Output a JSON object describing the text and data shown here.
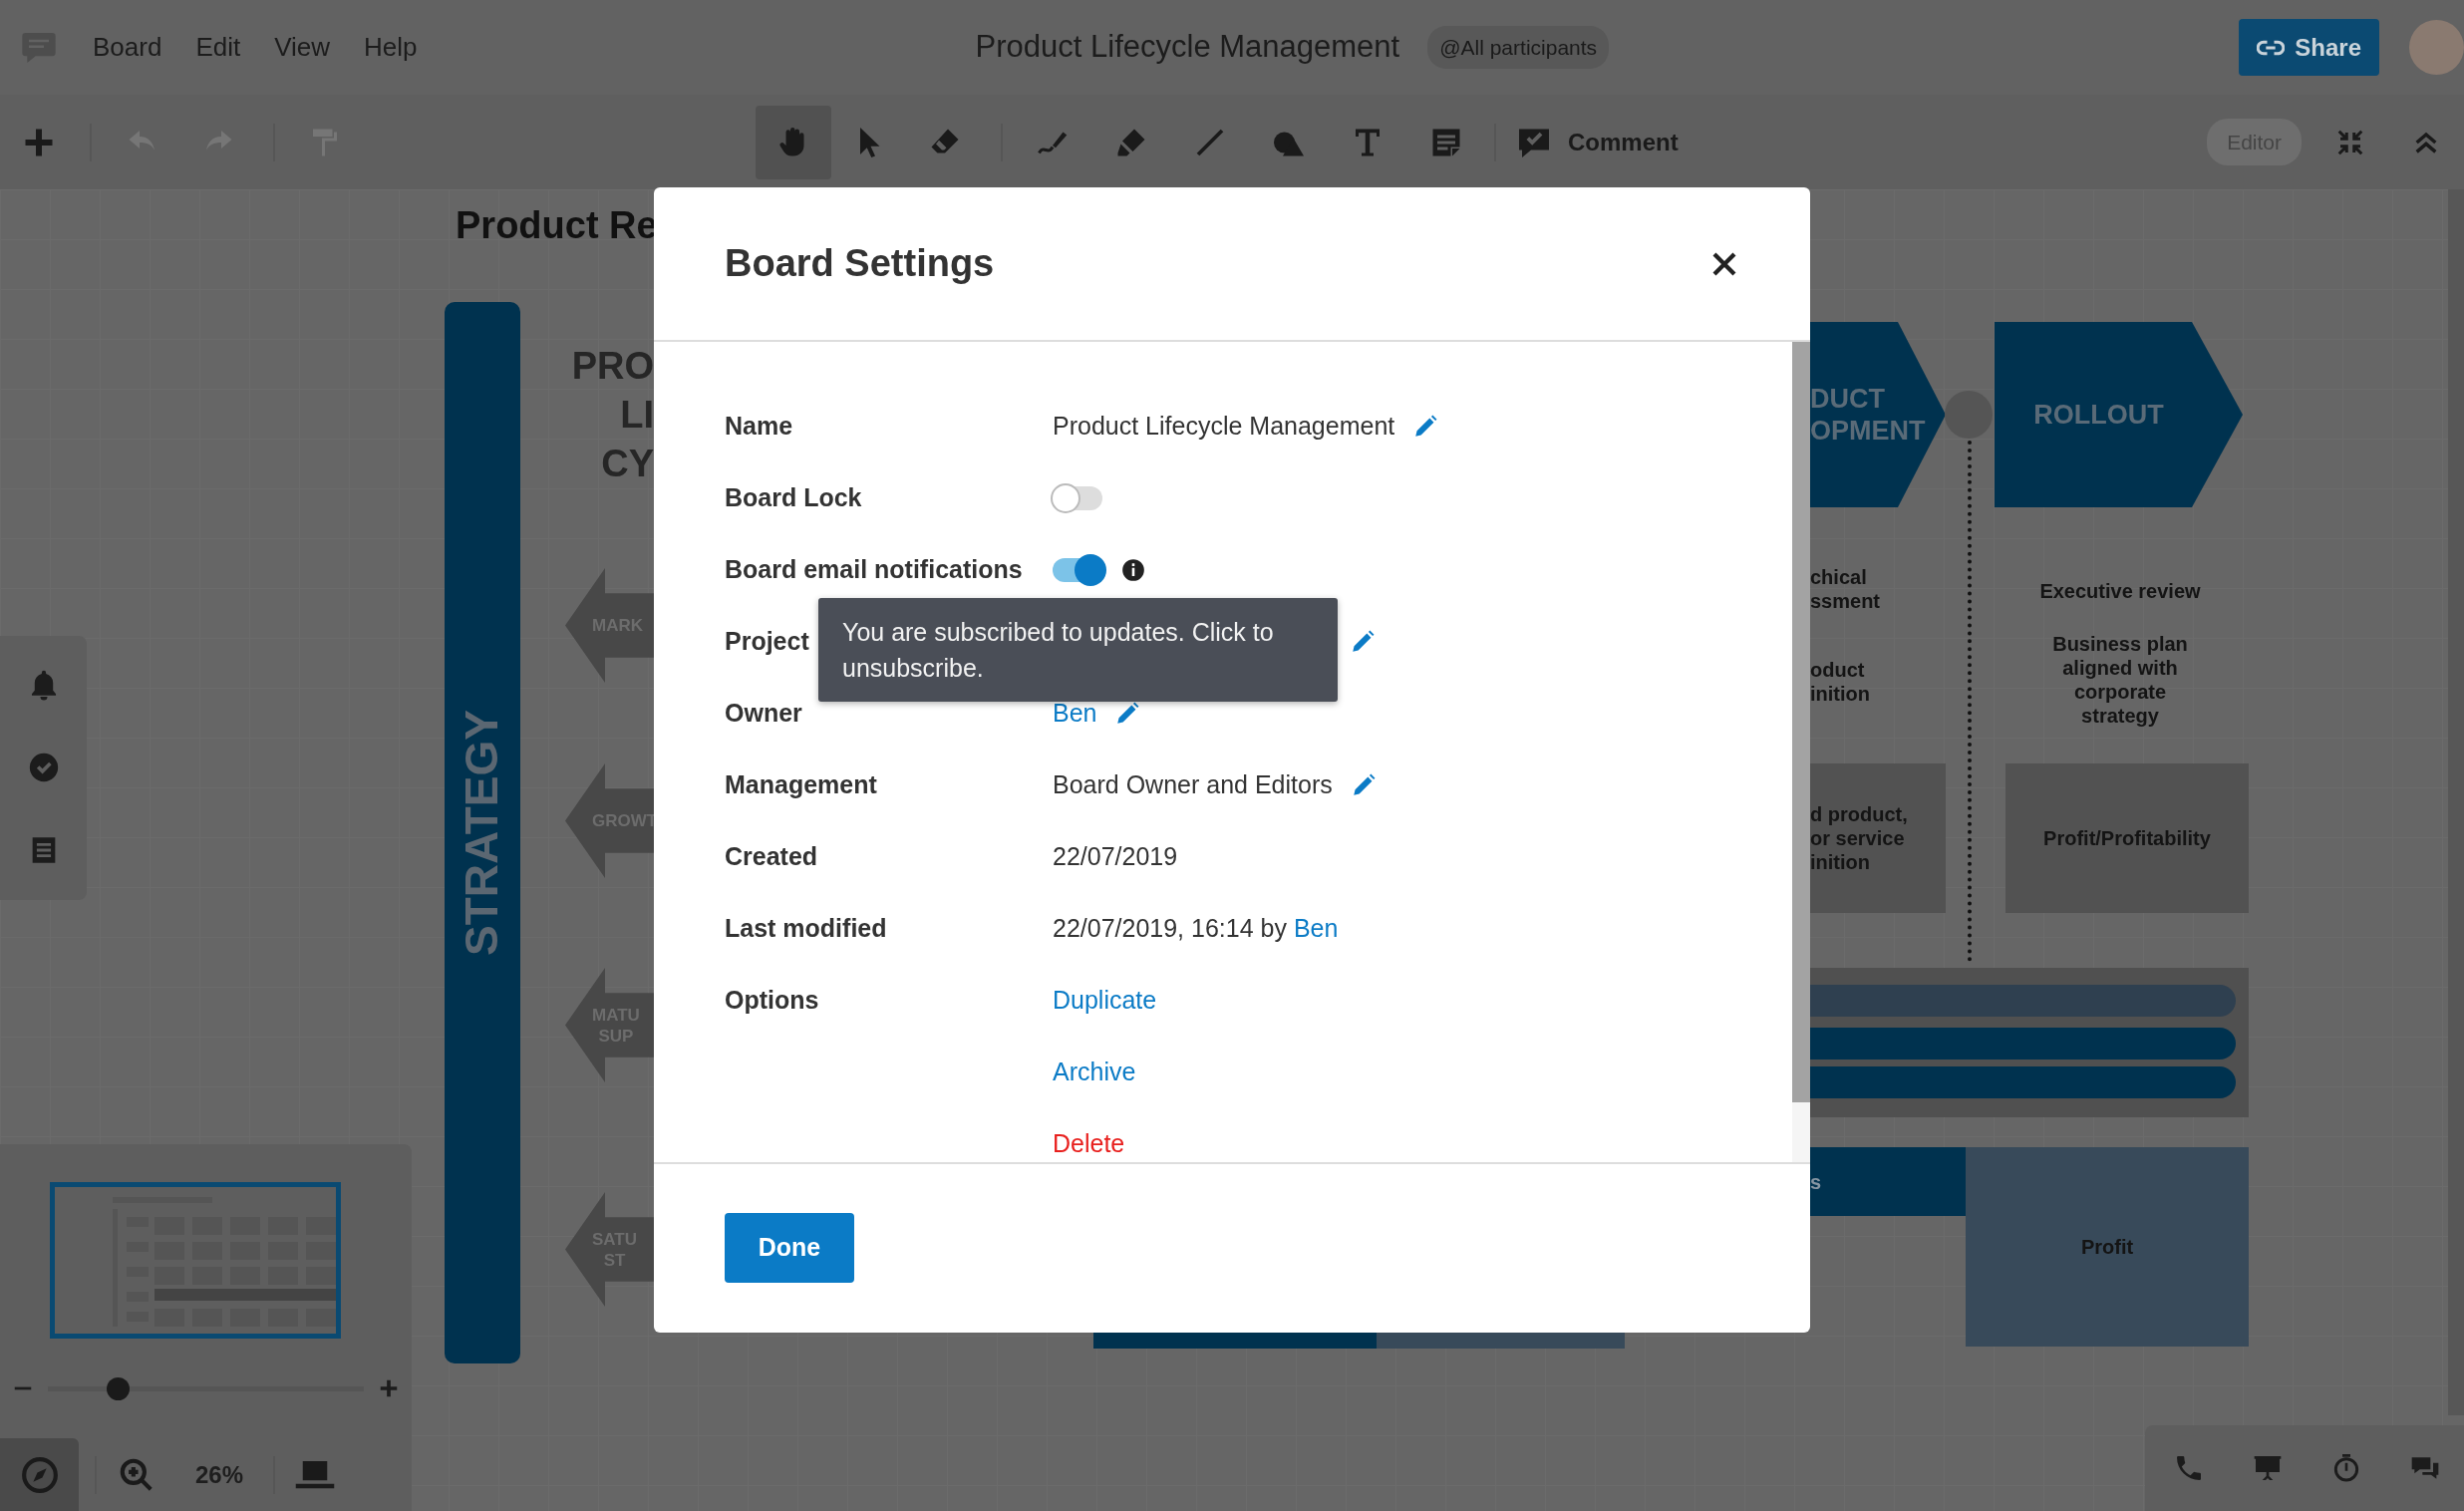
{
  "menu_bar": {
    "menus": [
      "Board",
      "Edit",
      "View",
      "Help"
    ],
    "board_title": "Product Lifecycle Management",
    "audience": "@All participants",
    "share": "Share"
  },
  "toolbar": {
    "tools": [
      {
        "kind": "add",
        "selected": false,
        "disabled": false
      },
      {
        "kind": "undo",
        "selected": false,
        "disabled": true
      },
      {
        "kind": "redo",
        "selected": false,
        "disabled": true
      },
      {
        "kind": "format",
        "selected": false,
        "disabled": true
      },
      {
        "kind": "hand",
        "selected": true,
        "disabled": false
      },
      {
        "kind": "pointer",
        "selected": false,
        "disabled": false
      },
      {
        "kind": "eraser",
        "selected": false,
        "disabled": false
      },
      {
        "kind": "pen",
        "selected": false,
        "disabled": false
      },
      {
        "kind": "marker",
        "selected": false,
        "disabled": false
      },
      {
        "kind": "line",
        "selected": false,
        "disabled": false
      },
      {
        "kind": "shapes",
        "selected": false,
        "disabled": false
      },
      {
        "kind": "text",
        "selected": false,
        "disabled": false
      },
      {
        "kind": "note",
        "selected": false,
        "disabled": false
      },
      {
        "kind": "comment",
        "label": "Comment",
        "selected": false,
        "disabled": false
      }
    ],
    "mode_badge": "Editor"
  },
  "canvas": {
    "title": "Product Re",
    "side_band": "STRATEGY",
    "heading_lines": [
      "PRO",
      "LI",
      "CY"
    ],
    "stage_arrows": [
      [
        "MARK"
      ],
      [
        "GROWT"
      ],
      [
        "MATU",
        "SUP"
      ],
      [
        "SATU",
        "ST"
      ]
    ],
    "phases": [
      [
        "DUCT",
        "OPMENT"
      ],
      [
        "ROLLOUT"
      ]
    ],
    "notes": [
      [
        "chical",
        "ssment"
      ],
      [
        "oduct",
        "inition"
      ],
      [
        "Executive review"
      ],
      [
        "Business plan",
        "aligned with",
        "corporate",
        "strategy"
      ]
    ],
    "boxes": [
      [
        "d product,",
        "or service",
        "inition"
      ],
      [
        "Profit/Profitability"
      ]
    ],
    "bottom_blocks": [
      [
        "s"
      ],
      [
        "Profit"
      ]
    ]
  },
  "navigator": {
    "zoom_level": "26%",
    "zoom_slider": {
      "level": 0.22
    },
    "compass_selected": true
  },
  "dialog": {
    "title": "Board Settings",
    "rows": [
      {
        "label": "Name",
        "kind": "text",
        "value": "Product Lifecycle Management",
        "editable": true
      },
      {
        "label": "Board Lock",
        "kind": "toggle",
        "on": false
      },
      {
        "label": "Board email notifications",
        "kind": "toggle",
        "on": true,
        "info": true
      },
      {
        "label": "Project",
        "kind": "text",
        "editable": true
      },
      {
        "label": "Owner",
        "kind": "link",
        "value": "Ben",
        "editable": true
      },
      {
        "label": "Management",
        "kind": "text",
        "value": "Board Owner and Editors",
        "editable": true
      },
      {
        "label": "Created",
        "kind": "text",
        "value": "22/07/2019"
      },
      {
        "label": "Last modified",
        "kind": "text",
        "value": "22/07/2019, 16:14 by",
        "link": "Ben"
      },
      {
        "label": "Options",
        "kind": "actions",
        "actions": [
          {
            "label": "Duplicate",
            "danger": false
          },
          {
            "label": "Archive",
            "danger": false
          },
          {
            "label": "Delete",
            "danger": true
          }
        ]
      }
    ],
    "tooltip": "You are subscribed to updates. Click to unsubscribe.",
    "done_button": "Done"
  }
}
